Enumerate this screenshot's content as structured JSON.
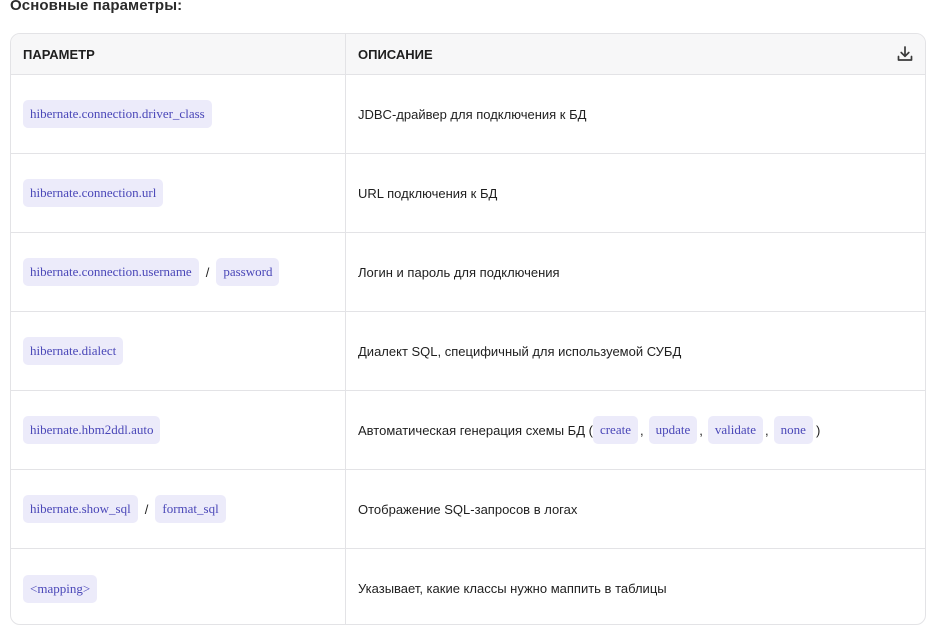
{
  "heading": "Основные параметры:",
  "table": {
    "headers": {
      "param": "ПАРАМЕТР",
      "desc": "ОПИСАНИЕ"
    },
    "download_icon": "download-icon",
    "rows": [
      {
        "param": [
          "hibernate.connection.driver_class"
        ],
        "desc": "JDBC-драйвер для подключения к БД"
      },
      {
        "param": [
          "hibernate.connection.url"
        ],
        "desc": "URL подключения к БД"
      },
      {
        "param": [
          "hibernate.connection.username",
          "password"
        ],
        "param_sep": "/",
        "desc": "Логин и пароль для подключения"
      },
      {
        "param": [
          "hibernate.dialect"
        ],
        "desc": "Диалект SQL, специфичный для используемой СУБД"
      },
      {
        "param": [
          "hibernate.hbm2ddl.auto"
        ],
        "desc_prefix": "Автоматическая генерация схемы БД (",
        "desc_codes": [
          "create",
          "update",
          "validate",
          "none"
        ],
        "desc_suffix": ")"
      },
      {
        "param": [
          "hibernate.show_sql",
          "format_sql"
        ],
        "param_sep": "/",
        "desc": "Отображение SQL-запросов в логах"
      },
      {
        "param": [
          "<mapping>"
        ],
        "desc": "Указывает, какие классы нужно маппить в таблицы"
      }
    ]
  },
  "colors": {
    "code_bg": "#ecebfa",
    "code_text": "#4a47b8",
    "border": "#e3e3e6",
    "header_bg": "#f7f7f8"
  }
}
